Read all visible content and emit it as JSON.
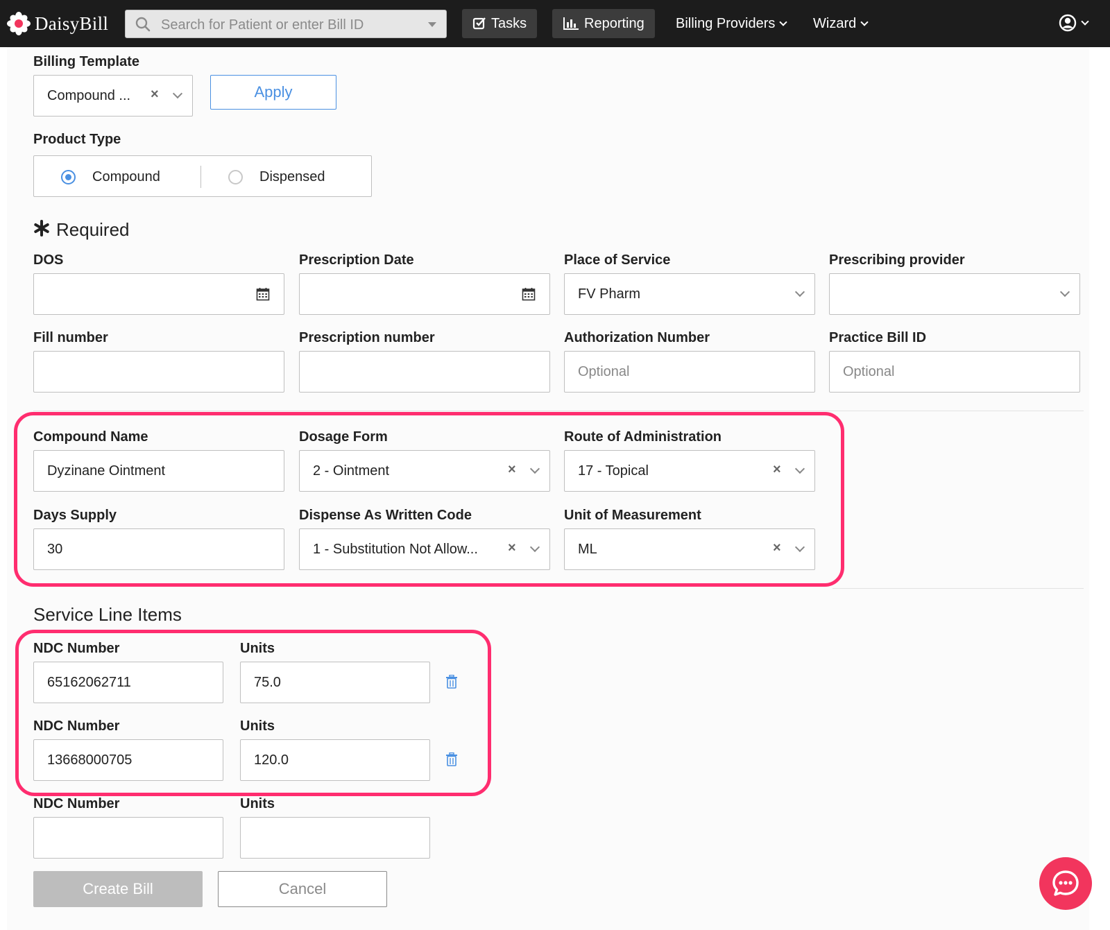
{
  "header": {
    "brand": "DaisyBill",
    "search_placeholder": "Search for Patient or enter Bill ID",
    "tasks_label": "Tasks",
    "reporting_label": "Reporting",
    "billing_providers_label": "Billing Providers",
    "wizard_label": "Wizard"
  },
  "template": {
    "label": "Billing Template",
    "value": "Compound ...",
    "apply_label": "Apply"
  },
  "product_type": {
    "label": "Product Type",
    "options": [
      "Compound",
      "Dispensed"
    ],
    "selected": "Compound"
  },
  "required": {
    "title": "Required",
    "dos_label": "DOS",
    "prescription_date_label": "Prescription Date",
    "place_of_service_label": "Place of Service",
    "place_of_service_value": "FV Pharm",
    "prescribing_provider_label": "Prescribing provider",
    "fill_number_label": "Fill number",
    "prescription_number_label": "Prescription number",
    "authorization_number_label": "Authorization Number",
    "authorization_number_placeholder": "Optional",
    "practice_bill_id_label": "Practice Bill ID",
    "practice_bill_id_placeholder": "Optional"
  },
  "compound": {
    "compound_name_label": "Compound Name",
    "compound_name_value": "Dyzinane Ointment",
    "dosage_form_label": "Dosage Form",
    "dosage_form_value": "2 - Ointment",
    "route_label": "Route of Administration",
    "route_value": "17 - Topical",
    "days_supply_label": "Days Supply",
    "days_supply_value": "30",
    "daw_label": "Dispense As Written Code",
    "daw_value": "1 - Substitution Not Allow...",
    "uom_label": "Unit of Measurement",
    "uom_value": "ML"
  },
  "service_lines": {
    "title": "Service Line Items",
    "ndc_label": "NDC Number",
    "units_label": "Units",
    "items": [
      {
        "ndc": "65162062711",
        "units": "75.0"
      },
      {
        "ndc": "13668000705",
        "units": "120.0"
      },
      {
        "ndc": "",
        "units": ""
      }
    ]
  },
  "actions": {
    "create_label": "Create Bill",
    "cancel_label": "Cancel"
  },
  "colors": {
    "accent": "#4a90e2",
    "highlight": "#ff2d6f",
    "chat": "#f2355d",
    "topbar": "#1c1c1c"
  }
}
